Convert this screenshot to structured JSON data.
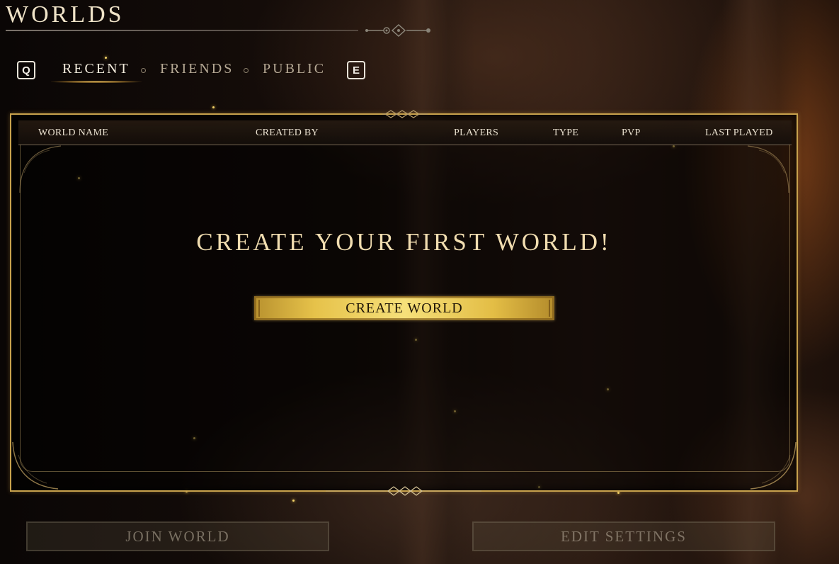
{
  "title": "WORLDS",
  "tabs": {
    "prev_key": "Q",
    "next_key": "E",
    "items": [
      {
        "label": "RECENT",
        "active": true
      },
      {
        "label": "FRIENDS",
        "active": false
      },
      {
        "label": "PUBLIC",
        "active": false
      }
    ]
  },
  "table": {
    "columns": [
      "WORLD NAME",
      "CREATED BY",
      "PLAYERS",
      "TYPE",
      "PVP",
      "LAST PLAYED"
    ],
    "rows": []
  },
  "empty_state": {
    "headline": "CREATE YOUR FIRST WORLD!",
    "button_label": "CREATE WORLD"
  },
  "footer": {
    "join_label": "JOIN WORLD",
    "edit_label": "EDIT SETTINGS",
    "join_enabled": false,
    "edit_enabled": false
  },
  "colors": {
    "accent_gold": "#c8a24d",
    "button_gold": "#f6e07a",
    "title_text": "#efe3c8",
    "headline_text": "#f1ddb0"
  }
}
